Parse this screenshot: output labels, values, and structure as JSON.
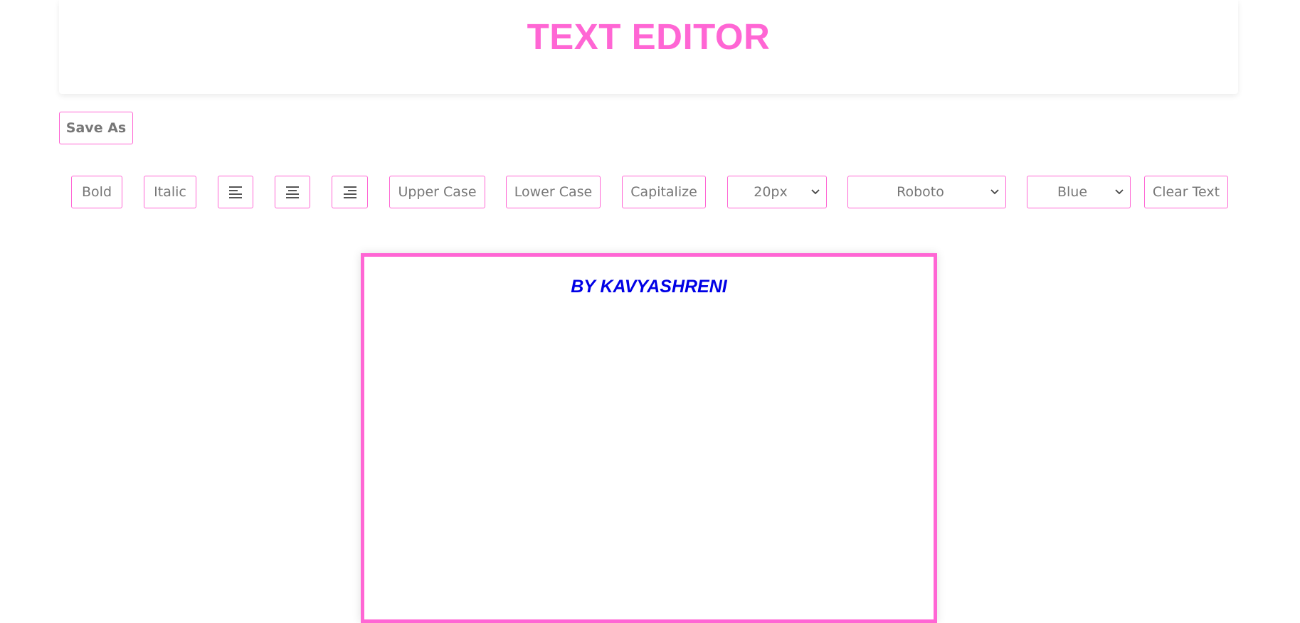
{
  "header": {
    "title": "TEXT EDITOR"
  },
  "actions": {
    "save_as_label": "Save As"
  },
  "toolbar": {
    "bold_label": "Bold",
    "italic_label": "Italic",
    "align_left_icon": "align-left-icon",
    "align_center_icon": "align-center-icon",
    "align_right_icon": "align-right-icon",
    "upper_case_label": "Upper Case",
    "lower_case_label": "Lower Case",
    "capitalize_label": "Capitalize",
    "font_size_value": "20px",
    "font_family_value": "Roboto",
    "color_value": "Blue",
    "clear_text_label": "Clear Text"
  },
  "editor": {
    "text": "BY KAVYASHRENI",
    "text_color": "#0000e6"
  },
  "colors": {
    "accent": "#ff66d4"
  }
}
